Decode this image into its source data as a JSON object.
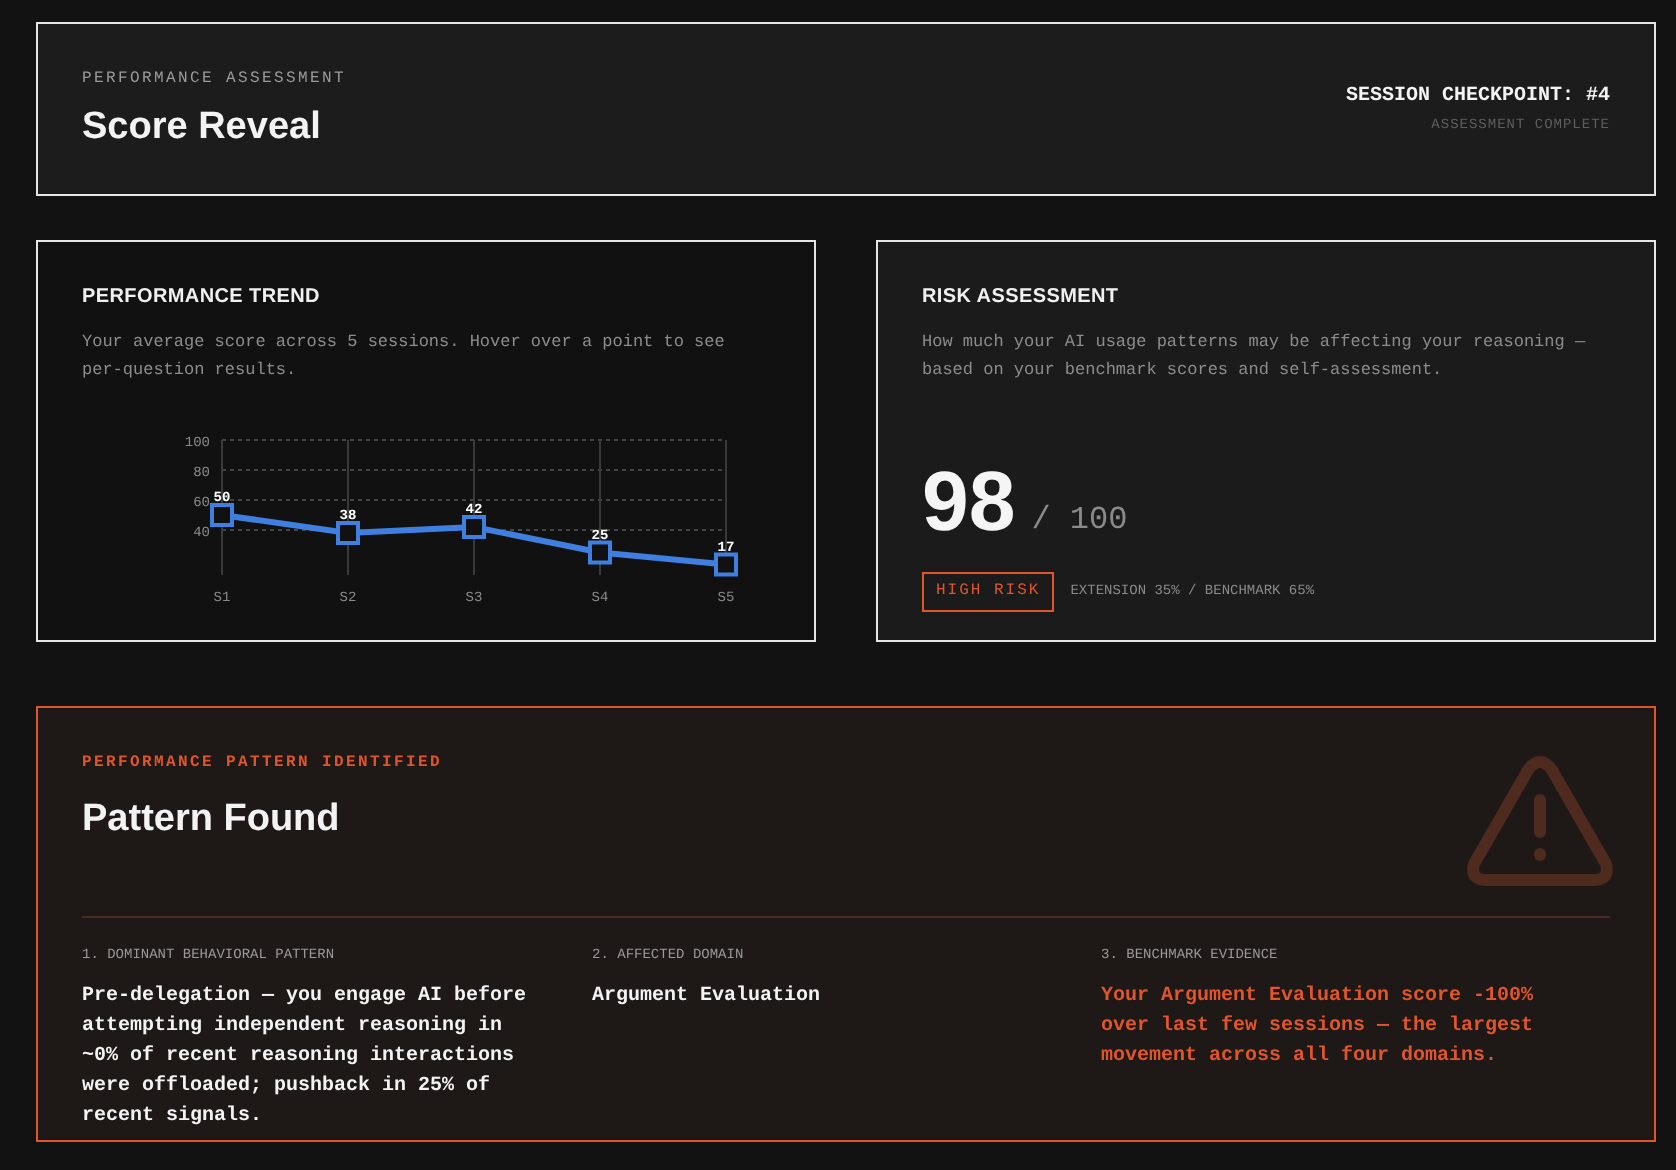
{
  "header": {
    "eyebrow": "PERFORMANCE ASSESSMENT",
    "title": "Score Reveal",
    "checkpoint": "SESSION CHECKPOINT: #4",
    "status": "ASSESSMENT COMPLETE"
  },
  "trend": {
    "title": "PERFORMANCE TREND",
    "description": "Your average score across 5 sessions. Hover over a point to see per-question results.",
    "chart_data": {
      "type": "line",
      "categories": [
        "S1",
        "S2",
        "S3",
        "S4",
        "S5"
      ],
      "yticks": [
        40,
        60,
        80,
        100
      ],
      "ylim": [
        10,
        100
      ],
      "grid": true,
      "data_labels": true,
      "series": [
        {
          "color": "#3f7fe0",
          "marker": "square",
          "values": [
            50,
            38,
            42,
            25,
            17
          ]
        }
      ]
    }
  },
  "risk": {
    "title": "RISK ASSESSMENT",
    "description": "How much your AI usage patterns may be affecting your reasoning — based on your benchmark scores and self-assessment.",
    "score": "98",
    "out_of": "/ 100",
    "badge": "HIGH RISK",
    "breakdown": "EXTENSION 35% / BENCHMARK 65%"
  },
  "pattern": {
    "eyebrow": "PERFORMANCE PATTERN IDENTIFIED",
    "title": "Pattern Found",
    "columns": [
      {
        "label": "1. DOMINANT BEHAVIORAL PATTERN",
        "text": "Pre-delegation — you engage AI before attempting independent reasoning in ~0% of recent reasoning interactions were offloaded; pushback in 25% of recent signals.",
        "highlight": false
      },
      {
        "label": "2. AFFECTED DOMAIN",
        "text": "Argument Evaluation",
        "highlight": false
      },
      {
        "label": "3. BENCHMARK EVIDENCE",
        "text": "Your Argument Evaluation score -100% over last few sessions — the largest movement across all four domains.",
        "highlight": true
      }
    ]
  }
}
